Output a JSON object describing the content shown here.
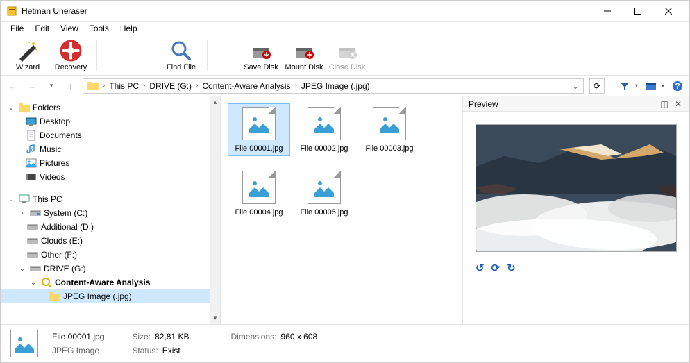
{
  "window": {
    "title": "Hetman Uneraser"
  },
  "menu": {
    "file": "File",
    "edit": "Edit",
    "view": "View",
    "tools": "Tools",
    "help": "Help"
  },
  "toolbar": {
    "wizard": "Wizard",
    "recovery": "Recovery",
    "find": "Find File",
    "save": "Save Disk",
    "mount": "Mount Disk",
    "close": "Close Disk"
  },
  "breadcrumb": {
    "thispc": "This PC",
    "drive": "DRIVE (G:)",
    "analysis": "Content-Aware Analysis",
    "type": "JPEG Image (.jpg)"
  },
  "tree": {
    "folders": "Folders",
    "desktop": "Desktop",
    "documents": "Documents",
    "music": "Music",
    "pictures": "Pictures",
    "videos": "Videos",
    "thispc": "This PC",
    "sysc": "System (C:)",
    "addd": "Additional (D:)",
    "cloudse": "Clouds (E:)",
    "otherf": "Other (F:)",
    "driveg": "DRIVE (G:)",
    "caa": "Content-Aware Analysis",
    "jpeg": "JPEG Image (.jpg)"
  },
  "files": {
    "f1": "File 00001.jpg",
    "f2": "File 00002.jpg",
    "f3": "File 00003.jpg",
    "f4": "File 00004.jpg",
    "f5": "File 00005.jpg"
  },
  "preview": {
    "title": "Preview"
  },
  "status": {
    "name": "File 00001.jpg",
    "type": "JPEG Image",
    "size_l": "Size:",
    "size_v": "82,81 KB",
    "stat_l": "Status:",
    "stat_v": "Exist",
    "dim_l": "Dimensions:",
    "dim_v": "960 x 608"
  }
}
